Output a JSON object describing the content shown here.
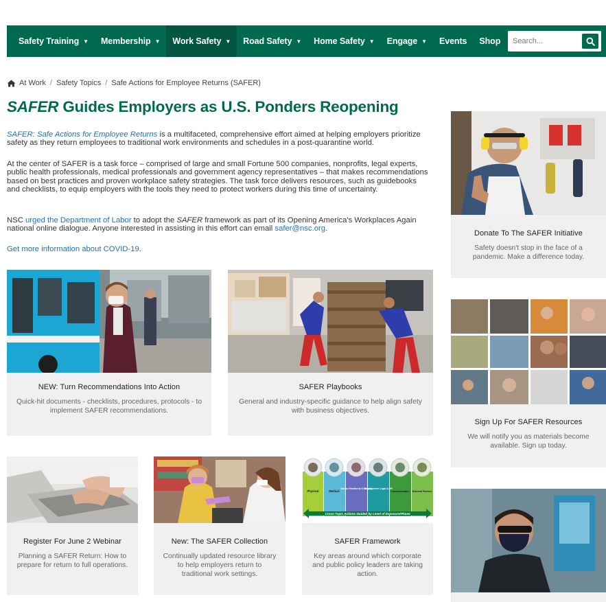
{
  "nav": {
    "items": [
      {
        "label": "Safety Training",
        "caret": true
      },
      {
        "label": "Membership",
        "caret": true
      },
      {
        "label": "Work Safety",
        "caret": true,
        "active": true
      },
      {
        "label": "Road Safety",
        "caret": true
      },
      {
        "label": "Home Safety",
        "caret": true
      },
      {
        "label": "Engage",
        "caret": true
      },
      {
        "label": "Events",
        "caret": false
      },
      {
        "label": "Shop",
        "caret": false
      }
    ],
    "search_placeholder": "Search...",
    "search_icon": "search-icon"
  },
  "breadcrumb": {
    "home_icon": "home-icon",
    "items": [
      "At Work",
      "Safety Topics",
      "Safe Actions for Employee Returns (SAFER)"
    ]
  },
  "title": {
    "emphasis": "SAFER",
    "rest": " Guides Employers as U.S. Ponders Reopening"
  },
  "intro": {
    "p1_link": "SAFER: Safe Actions for Employee Returns",
    "p1_text": " is a multifaceted, comprehensive effort aimed at helping employers prioritize safety as they return employees to traditional work environments and schedules in a post-quarantine world.",
    "p2_text": "At the center of SAFER is a task force – comprised of large and small Fortune 500 companies, nonprofits, legal experts, public health professionals, medical professionals and government agency representatives – that makes recommendations based on best practices and proven workplace safety strategies. The task force delivers resources, such as guidebooks and checklists, to equip employers with the tools they need to protect workers during this time of uncertainty.",
    "p3_start": "NSC ",
    "p3_link": "urged the Department of Labor",
    "p3_mid": " to adopt the ",
    "p3_em": "SAFER",
    "p3_end": " framework as part of its Opening America's Workplaces Again national online dialogue. Anyone interested in assisting in this effort can email ",
    "p3_email": "safer@nsc.org",
    "p3_period": ".",
    "p4_link": "Get more information about COVID-19",
    "p4_period": "."
  },
  "cards": {
    "recommendations": {
      "title": "NEW: Turn Recommendations Into Action",
      "desc": "Quick-hit documents - checklists, procedures, protocols - to implement SAFER recommendations."
    },
    "playbooks": {
      "title": "SAFER Playbooks",
      "desc": "General and industry-specific guidance to help align safety with business objectives."
    },
    "webinar": {
      "title": "Register For June 2 Webinar",
      "desc": "Planning a SAFER Return: How to prepare for return to full operations."
    },
    "collection": {
      "title": "New: The SAFER Collection",
      "desc": "Continually updated resource library to help employers return to traditional work settings."
    },
    "framework": {
      "title": "SAFER Framework",
      "desc": "Key areas around which corporate and public policy leaders are taking action.",
      "columns": [
        "Physical",
        "Medical",
        "Stress Emotional & Mental",
        "Employment Legal & HR",
        "Communication",
        "External Factors"
      ],
      "banner": "Cross-Topic Actions Guided by Level of Exposure/Phase"
    }
  },
  "sidebar": {
    "donate": {
      "title": "Donate To The SAFER Initiative",
      "desc": "Safety doesn't stop in the face of a pandemic. Make a difference today."
    },
    "signup": {
      "title": "Sign Up For SAFER Resources",
      "desc": "We will notify you as materials become available. Sign up today."
    }
  },
  "colors": {
    "brand_green": "#006a4e",
    "link_blue": "#1f6fb5",
    "card_bg": "#f0f0f0"
  }
}
